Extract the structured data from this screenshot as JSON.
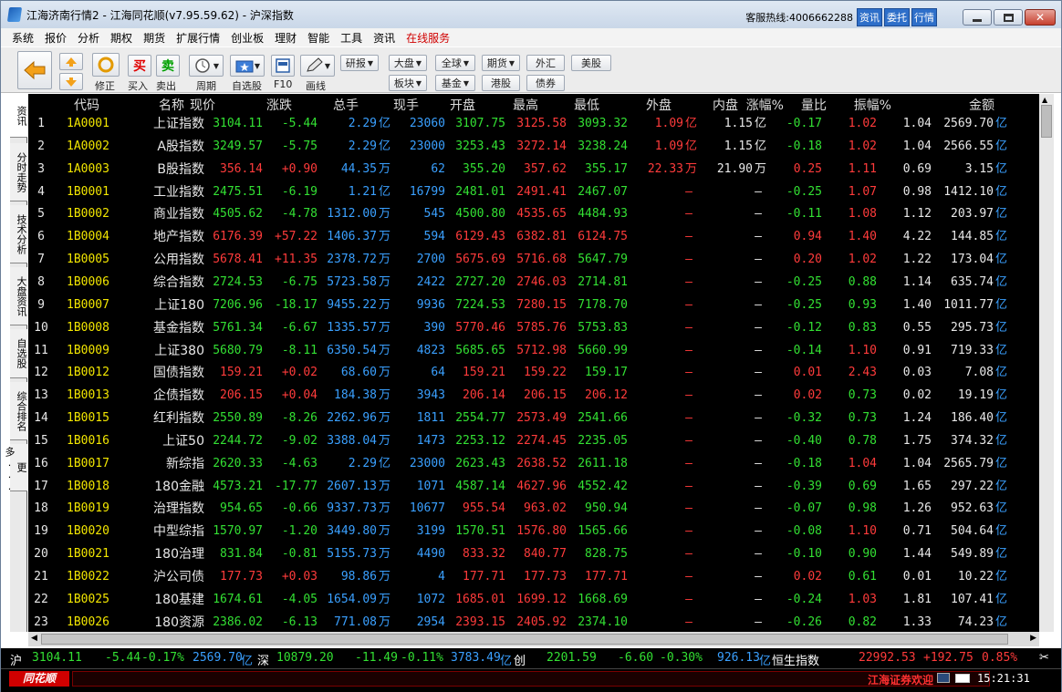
{
  "window": {
    "title": "江海济南行情2 - 江海同花顺(v7.95.59.62) - 沪深指数",
    "hotline_label": "客服热线:",
    "hotline_number": "4006662288",
    "top_buttons": [
      "资讯",
      "委托",
      "行情"
    ]
  },
  "menu": [
    "系统",
    "报价",
    "分析",
    "期权",
    "期货",
    "扩展行情",
    "创业板",
    "理财",
    "智能",
    "工具",
    "资讯",
    "在线服务"
  ],
  "toolbar": {
    "modify": "修正",
    "buy": "买",
    "sell": "卖",
    "buy_in": "买入",
    "sell_out": "卖出",
    "period": "周期",
    "self_select": "自选股",
    "f10": "F10",
    "draw": "画线",
    "research": "研报",
    "dapan": "大盘",
    "global": "全球",
    "futures": "期货",
    "forex": "外汇",
    "usstock": "美股",
    "sector": "板块",
    "fund": "基金",
    "hkstock": "港股",
    "bond": "债券",
    "f10_icon_text": "F10"
  },
  "side_tabs": [
    "资讯",
    "分时走势",
    "技术分析",
    "大盘资讯",
    "自选股",
    "综合排名",
    "更多..."
  ],
  "colors": {
    "up": "#ff3b3b",
    "down": "#33e033",
    "neutral": "#e8e8e8",
    "code": "#f2e600",
    "price_neutral": "#e8e8e8",
    "blue_unit": "#3aa0ff"
  },
  "headers": [
    "代码",
    "名称",
    "现价",
    "涨跌",
    "总手",
    "现手",
    "开盘",
    "最高",
    "最低",
    "外盘",
    "内盘",
    "涨幅%",
    "量比",
    "振幅%",
    "金额"
  ],
  "rows": [
    {
      "no": "1",
      "code": "1A0001",
      "name": "上证指数",
      "price": "3104.11",
      "chg": "-5.44",
      "vol": "2.29",
      "vol_unit": "亿",
      "now": "23060",
      "open": "3107.75",
      "high": "3125.58",
      "low": "3093.32",
      "outer": "1.09",
      "outer_unit": "亿",
      "inner": "1.15",
      "inner_unit": "亿",
      "pct": "-0.17",
      "vr": "1.02",
      "amp": "1.04",
      "amt": "2569.70",
      "amt_unit": "亿",
      "dir": "down"
    },
    {
      "no": "2",
      "code": "1A0002",
      "name": "A股指数",
      "price": "3249.57",
      "chg": "-5.75",
      "vol": "2.29",
      "vol_unit": "亿",
      "now": "23000",
      "open": "3253.43",
      "high": "3272.14",
      "low": "3238.24",
      "outer": "1.09",
      "outer_unit": "亿",
      "inner": "1.15",
      "inner_unit": "亿",
      "pct": "-0.18",
      "vr": "1.02",
      "amp": "1.04",
      "amt": "2566.55",
      "amt_unit": "亿",
      "dir": "down"
    },
    {
      "no": "3",
      "code": "1A0003",
      "name": "B股指数",
      "price": "356.14",
      "chg": "+0.90",
      "vol": "44.35",
      "vol_unit": "万",
      "now": "62",
      "open": "355.20",
      "high": "357.62",
      "low": "355.17",
      "outer": "22.33",
      "outer_unit": "万",
      "inner": "21.90",
      "inner_unit": "万",
      "pct": "0.25",
      "vr": "1.11",
      "amp": "0.69",
      "amt": "3.15",
      "amt_unit": "亿",
      "dir": "up"
    },
    {
      "no": "4",
      "code": "1B0001",
      "name": "工业指数",
      "price": "2475.51",
      "chg": "-6.19",
      "vol": "1.21",
      "vol_unit": "亿",
      "now": "16799",
      "open": "2481.01",
      "high": "2491.41",
      "low": "2467.07",
      "outer": "–",
      "outer_unit": "",
      "inner": "–",
      "inner_unit": "",
      "pct": "-0.25",
      "vr": "1.07",
      "amp": "0.98",
      "amt": "1412.10",
      "amt_unit": "亿",
      "dir": "down"
    },
    {
      "no": "5",
      "code": "1B0002",
      "name": "商业指数",
      "price": "4505.62",
      "chg": "-4.78",
      "vol": "1312.00",
      "vol_unit": "万",
      "now": "545",
      "open": "4500.80",
      "high": "4535.65",
      "low": "4484.93",
      "outer": "–",
      "outer_unit": "",
      "inner": "–",
      "inner_unit": "",
      "pct": "-0.11",
      "vr": "1.08",
      "amp": "1.12",
      "amt": "203.97",
      "amt_unit": "亿",
      "dir": "down"
    },
    {
      "no": "6",
      "code": "1B0004",
      "name": "地产指数",
      "price": "6176.39",
      "chg": "+57.22",
      "vol": "1406.37",
      "vol_unit": "万",
      "now": "594",
      "open": "6129.43",
      "high": "6382.81",
      "low": "6124.75",
      "outer": "–",
      "outer_unit": "",
      "inner": "–",
      "inner_unit": "",
      "pct": "0.94",
      "vr": "1.40",
      "amp": "4.22",
      "amt": "144.85",
      "amt_unit": "亿",
      "dir": "up"
    },
    {
      "no": "7",
      "code": "1B0005",
      "name": "公用指数",
      "price": "5678.41",
      "chg": "+11.35",
      "vol": "2378.72",
      "vol_unit": "万",
      "now": "2700",
      "open": "5675.69",
      "high": "5716.68",
      "low": "5647.79",
      "outer": "–",
      "outer_unit": "",
      "inner": "–",
      "inner_unit": "",
      "pct": "0.20",
      "vr": "1.02",
      "amp": "1.22",
      "amt": "173.04",
      "amt_unit": "亿",
      "dir": "up"
    },
    {
      "no": "8",
      "code": "1B0006",
      "name": "综合指数",
      "price": "2724.53",
      "chg": "-6.75",
      "vol": "5723.58",
      "vol_unit": "万",
      "now": "2422",
      "open": "2727.20",
      "high": "2746.03",
      "low": "2714.81",
      "outer": "–",
      "outer_unit": "",
      "inner": "–",
      "inner_unit": "",
      "pct": "-0.25",
      "vr": "0.88",
      "amp": "1.14",
      "amt": "635.74",
      "amt_unit": "亿",
      "dir": "down"
    },
    {
      "no": "9",
      "code": "1B0007",
      "name": "上证180",
      "price": "7206.96",
      "chg": "-18.17",
      "vol": "9455.22",
      "vol_unit": "万",
      "now": "9936",
      "open": "7224.53",
      "high": "7280.15",
      "low": "7178.70",
      "outer": "–",
      "outer_unit": "",
      "inner": "–",
      "inner_unit": "",
      "pct": "-0.25",
      "vr": "0.93",
      "amp": "1.40",
      "amt": "1011.77",
      "amt_unit": "亿",
      "dir": "down"
    },
    {
      "no": "10",
      "code": "1B0008",
      "name": "基金指数",
      "price": "5761.34",
      "chg": "-6.67",
      "vol": "1335.57",
      "vol_unit": "万",
      "now": "390",
      "open": "5770.46",
      "high": "5785.76",
      "low": "5753.83",
      "outer": "–",
      "outer_unit": "",
      "inner": "–",
      "inner_unit": "",
      "pct": "-0.12",
      "vr": "0.83",
      "amp": "0.55",
      "amt": "295.73",
      "amt_unit": "亿",
      "dir": "down"
    },
    {
      "no": "11",
      "code": "1B0009",
      "name": "上证380",
      "price": "5680.79",
      "chg": "-8.11",
      "vol": "6350.54",
      "vol_unit": "万",
      "now": "4823",
      "open": "5685.65",
      "high": "5712.98",
      "low": "5660.99",
      "outer": "–",
      "outer_unit": "",
      "inner": "–",
      "inner_unit": "",
      "pct": "-0.14",
      "vr": "1.10",
      "amp": "0.91",
      "amt": "719.33",
      "amt_unit": "亿",
      "dir": "down"
    },
    {
      "no": "12",
      "code": "1B0012",
      "name": "国债指数",
      "price": "159.21",
      "chg": "+0.02",
      "vol": "68.60",
      "vol_unit": "万",
      "now": "64",
      "open": "159.21",
      "high": "159.22",
      "low": "159.17",
      "outer": "–",
      "outer_unit": "",
      "inner": "–",
      "inner_unit": "",
      "pct": "0.01",
      "vr": "2.43",
      "amp": "0.03",
      "amt": "7.08",
      "amt_unit": "亿",
      "dir": "up"
    },
    {
      "no": "13",
      "code": "1B0013",
      "name": "企债指数",
      "price": "206.15",
      "chg": "+0.04",
      "vol": "184.38",
      "vol_unit": "万",
      "now": "3943",
      "open": "206.14",
      "high": "206.15",
      "low": "206.12",
      "outer": "–",
      "outer_unit": "",
      "inner": "–",
      "inner_unit": "",
      "pct": "0.02",
      "vr": "0.73",
      "amp": "0.02",
      "amt": "19.19",
      "amt_unit": "亿",
      "dir": "up"
    },
    {
      "no": "14",
      "code": "1B0015",
      "name": "红利指数",
      "price": "2550.89",
      "chg": "-8.26",
      "vol": "2262.96",
      "vol_unit": "万",
      "now": "1811",
      "open": "2554.77",
      "high": "2573.49",
      "low": "2541.66",
      "outer": "–",
      "outer_unit": "",
      "inner": "–",
      "inner_unit": "",
      "pct": "-0.32",
      "vr": "0.73",
      "amp": "1.24",
      "amt": "186.40",
      "amt_unit": "亿",
      "dir": "down"
    },
    {
      "no": "15",
      "code": "1B0016",
      "name": "上证50",
      "price": "2244.72",
      "chg": "-9.02",
      "vol": "3388.04",
      "vol_unit": "万",
      "now": "1473",
      "open": "2253.12",
      "high": "2274.45",
      "low": "2235.05",
      "outer": "–",
      "outer_unit": "",
      "inner": "–",
      "inner_unit": "",
      "pct": "-0.40",
      "vr": "0.78",
      "amp": "1.75",
      "amt": "374.32",
      "amt_unit": "亿",
      "dir": "down"
    },
    {
      "no": "16",
      "code": "1B0017",
      "name": "新综指",
      "price": "2620.33",
      "chg": "-4.63",
      "vol": "2.29",
      "vol_unit": "亿",
      "now": "23000",
      "open": "2623.43",
      "high": "2638.52",
      "low": "2611.18",
      "outer": "–",
      "outer_unit": "",
      "inner": "–",
      "inner_unit": "",
      "pct": "-0.18",
      "vr": "1.04",
      "amp": "1.04",
      "amt": "2565.79",
      "amt_unit": "亿",
      "dir": "down"
    },
    {
      "no": "17",
      "code": "1B0018",
      "name": "180金融",
      "price": "4573.21",
      "chg": "-17.77",
      "vol": "2607.13",
      "vol_unit": "万",
      "now": "1071",
      "open": "4587.14",
      "high": "4627.96",
      "low": "4552.42",
      "outer": "–",
      "outer_unit": "",
      "inner": "–",
      "inner_unit": "",
      "pct": "-0.39",
      "vr": "0.69",
      "amp": "1.65",
      "amt": "297.22",
      "amt_unit": "亿",
      "dir": "down"
    },
    {
      "no": "18",
      "code": "1B0019",
      "name": "治理指数",
      "price": "954.65",
      "chg": "-0.66",
      "vol": "9337.73",
      "vol_unit": "万",
      "now": "10677",
      "open": "955.54",
      "high": "963.02",
      "low": "950.94",
      "outer": "–",
      "outer_unit": "",
      "inner": "–",
      "inner_unit": "",
      "pct": "-0.07",
      "vr": "0.98",
      "amp": "1.26",
      "amt": "952.63",
      "amt_unit": "亿",
      "dir": "down"
    },
    {
      "no": "19",
      "code": "1B0020",
      "name": "中型综指",
      "price": "1570.97",
      "chg": "-1.20",
      "vol": "3449.80",
      "vol_unit": "万",
      "now": "3199",
      "open": "1570.51",
      "high": "1576.80",
      "low": "1565.66",
      "outer": "–",
      "outer_unit": "",
      "inner": "–",
      "inner_unit": "",
      "pct": "-0.08",
      "vr": "1.10",
      "amp": "0.71",
      "amt": "504.64",
      "amt_unit": "亿",
      "dir": "down"
    },
    {
      "no": "20",
      "code": "1B0021",
      "name": "180治理",
      "price": "831.84",
      "chg": "-0.81",
      "vol": "5155.73",
      "vol_unit": "万",
      "now": "4490",
      "open": "833.32",
      "high": "840.77",
      "low": "828.75",
      "outer": "–",
      "outer_unit": "",
      "inner": "–",
      "inner_unit": "",
      "pct": "-0.10",
      "vr": "0.90",
      "amp": "1.44",
      "amt": "549.89",
      "amt_unit": "亿",
      "dir": "down"
    },
    {
      "no": "21",
      "code": "1B0022",
      "name": "沪公司债",
      "price": "177.73",
      "chg": "+0.03",
      "vol": "98.86",
      "vol_unit": "万",
      "now": "4",
      "open": "177.71",
      "high": "177.73",
      "low": "177.71",
      "outer": "–",
      "outer_unit": "",
      "inner": "–",
      "inner_unit": "",
      "pct": "0.02",
      "vr": "0.61",
      "amp": "0.01",
      "amt": "10.22",
      "amt_unit": "亿",
      "dir": "up"
    },
    {
      "no": "22",
      "code": "1B0025",
      "name": "180基建",
      "price": "1674.61",
      "chg": "-4.05",
      "vol": "1654.09",
      "vol_unit": "万",
      "now": "1072",
      "open": "1685.01",
      "high": "1699.12",
      "low": "1668.69",
      "outer": "–",
      "outer_unit": "",
      "inner": "–",
      "inner_unit": "",
      "pct": "-0.24",
      "vr": "1.03",
      "amp": "1.81",
      "amt": "107.41",
      "amt_unit": "亿",
      "dir": "down"
    },
    {
      "no": "23",
      "code": "1B0026",
      "name": "180资源",
      "price": "2386.02",
      "chg": "-6.13",
      "vol": "771.08",
      "vol_unit": "万",
      "now": "2954",
      "open": "2393.15",
      "high": "2405.92",
      "low": "2374.10",
      "outer": "–",
      "outer_unit": "",
      "inner": "–",
      "inner_unit": "",
      "pct": "-0.26",
      "vr": "0.82",
      "amp": "1.33",
      "amt": "74.23",
      "amt_unit": "亿",
      "dir": "down"
    }
  ],
  "ticker": {
    "sh_label": "沪",
    "sh_price": "3104.11",
    "sh_chg": "-5.44",
    "sh_pct": "-0.17%",
    "sh_amt": "2569.70",
    "sh_amt_unit": "亿",
    "sz_label": "深",
    "sz_price": "10879.20",
    "sz_chg": "-11.49",
    "sz_pct": "-0.11%",
    "sz_amt": "3783.49",
    "sz_amt_unit": "亿",
    "cy_label": "创",
    "cy_price": "2201.59",
    "cy_chg": "-6.60",
    "cy_pct": "-0.30%",
    "cy_amt": "926.13",
    "cy_amt_unit": "亿",
    "hs_label": "恒生指数",
    "hs_price": "22992.53",
    "hs_chg": "+192.75",
    "hs_pct": "0.85%"
  },
  "status": {
    "brand": "同花顺",
    "broker": "江海证券欢迎",
    "clock": "15:21:31"
  }
}
